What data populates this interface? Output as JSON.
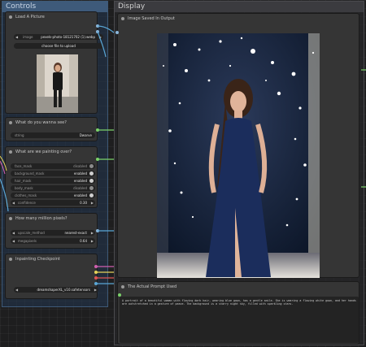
{
  "groups": {
    "controls_title": "Controls",
    "display_title": "Display"
  },
  "load_picture": {
    "title": "Load A Picture",
    "image_label": "image",
    "image_value": "pexels-photo-18121702 (1).webp",
    "upload_label": "choose file to upload"
  },
  "what_see": {
    "title": "What do you wanna see?",
    "string_label": "string",
    "string_value": "Dwarve"
  },
  "painting_over": {
    "title": "What are we painting over?",
    "rows": [
      {
        "label": "face_mask",
        "value": "disabled"
      },
      {
        "label": "background_mask",
        "value": "enabled"
      },
      {
        "label": "hair_mask",
        "value": "enabled"
      },
      {
        "label": "body_mask",
        "value": "disabled"
      },
      {
        "label": "clothes_mask",
        "value": "enabled"
      },
      {
        "label": "confidence",
        "value": "0.30"
      }
    ]
  },
  "million_pixels": {
    "title": "How many million pixels?",
    "upscale_label": "upscale_method",
    "upscale_value": "nearest-exact",
    "megapixels_label": "megapixels",
    "megapixels_value": "0.64"
  },
  "checkpoint": {
    "title": "Inpainting Checkpoint",
    "value": "dreamshaperXL_v10.safetensors"
  },
  "image_saved": {
    "title": "Image Saved In Output"
  },
  "prompt_used": {
    "title": "The Actual Prompt Used",
    "text": "A portrait of a beautiful woman with flowing dark hair, wearing blue gown, has a gentle smile. She is wearing a flowing white gown, and her hands are outstretched in a gesture of peace. The background is a starry night sky, filled with sparkling stars."
  },
  "colors": {
    "group_header": "#3e5a7a",
    "node_bg": "#353535",
    "wire_blue": "#5aa7d6",
    "wire_green": "#7bd36a",
    "wire_yellow": "#e6d35a",
    "wire_red": "#e05454",
    "wire_pink": "#d060b0"
  }
}
